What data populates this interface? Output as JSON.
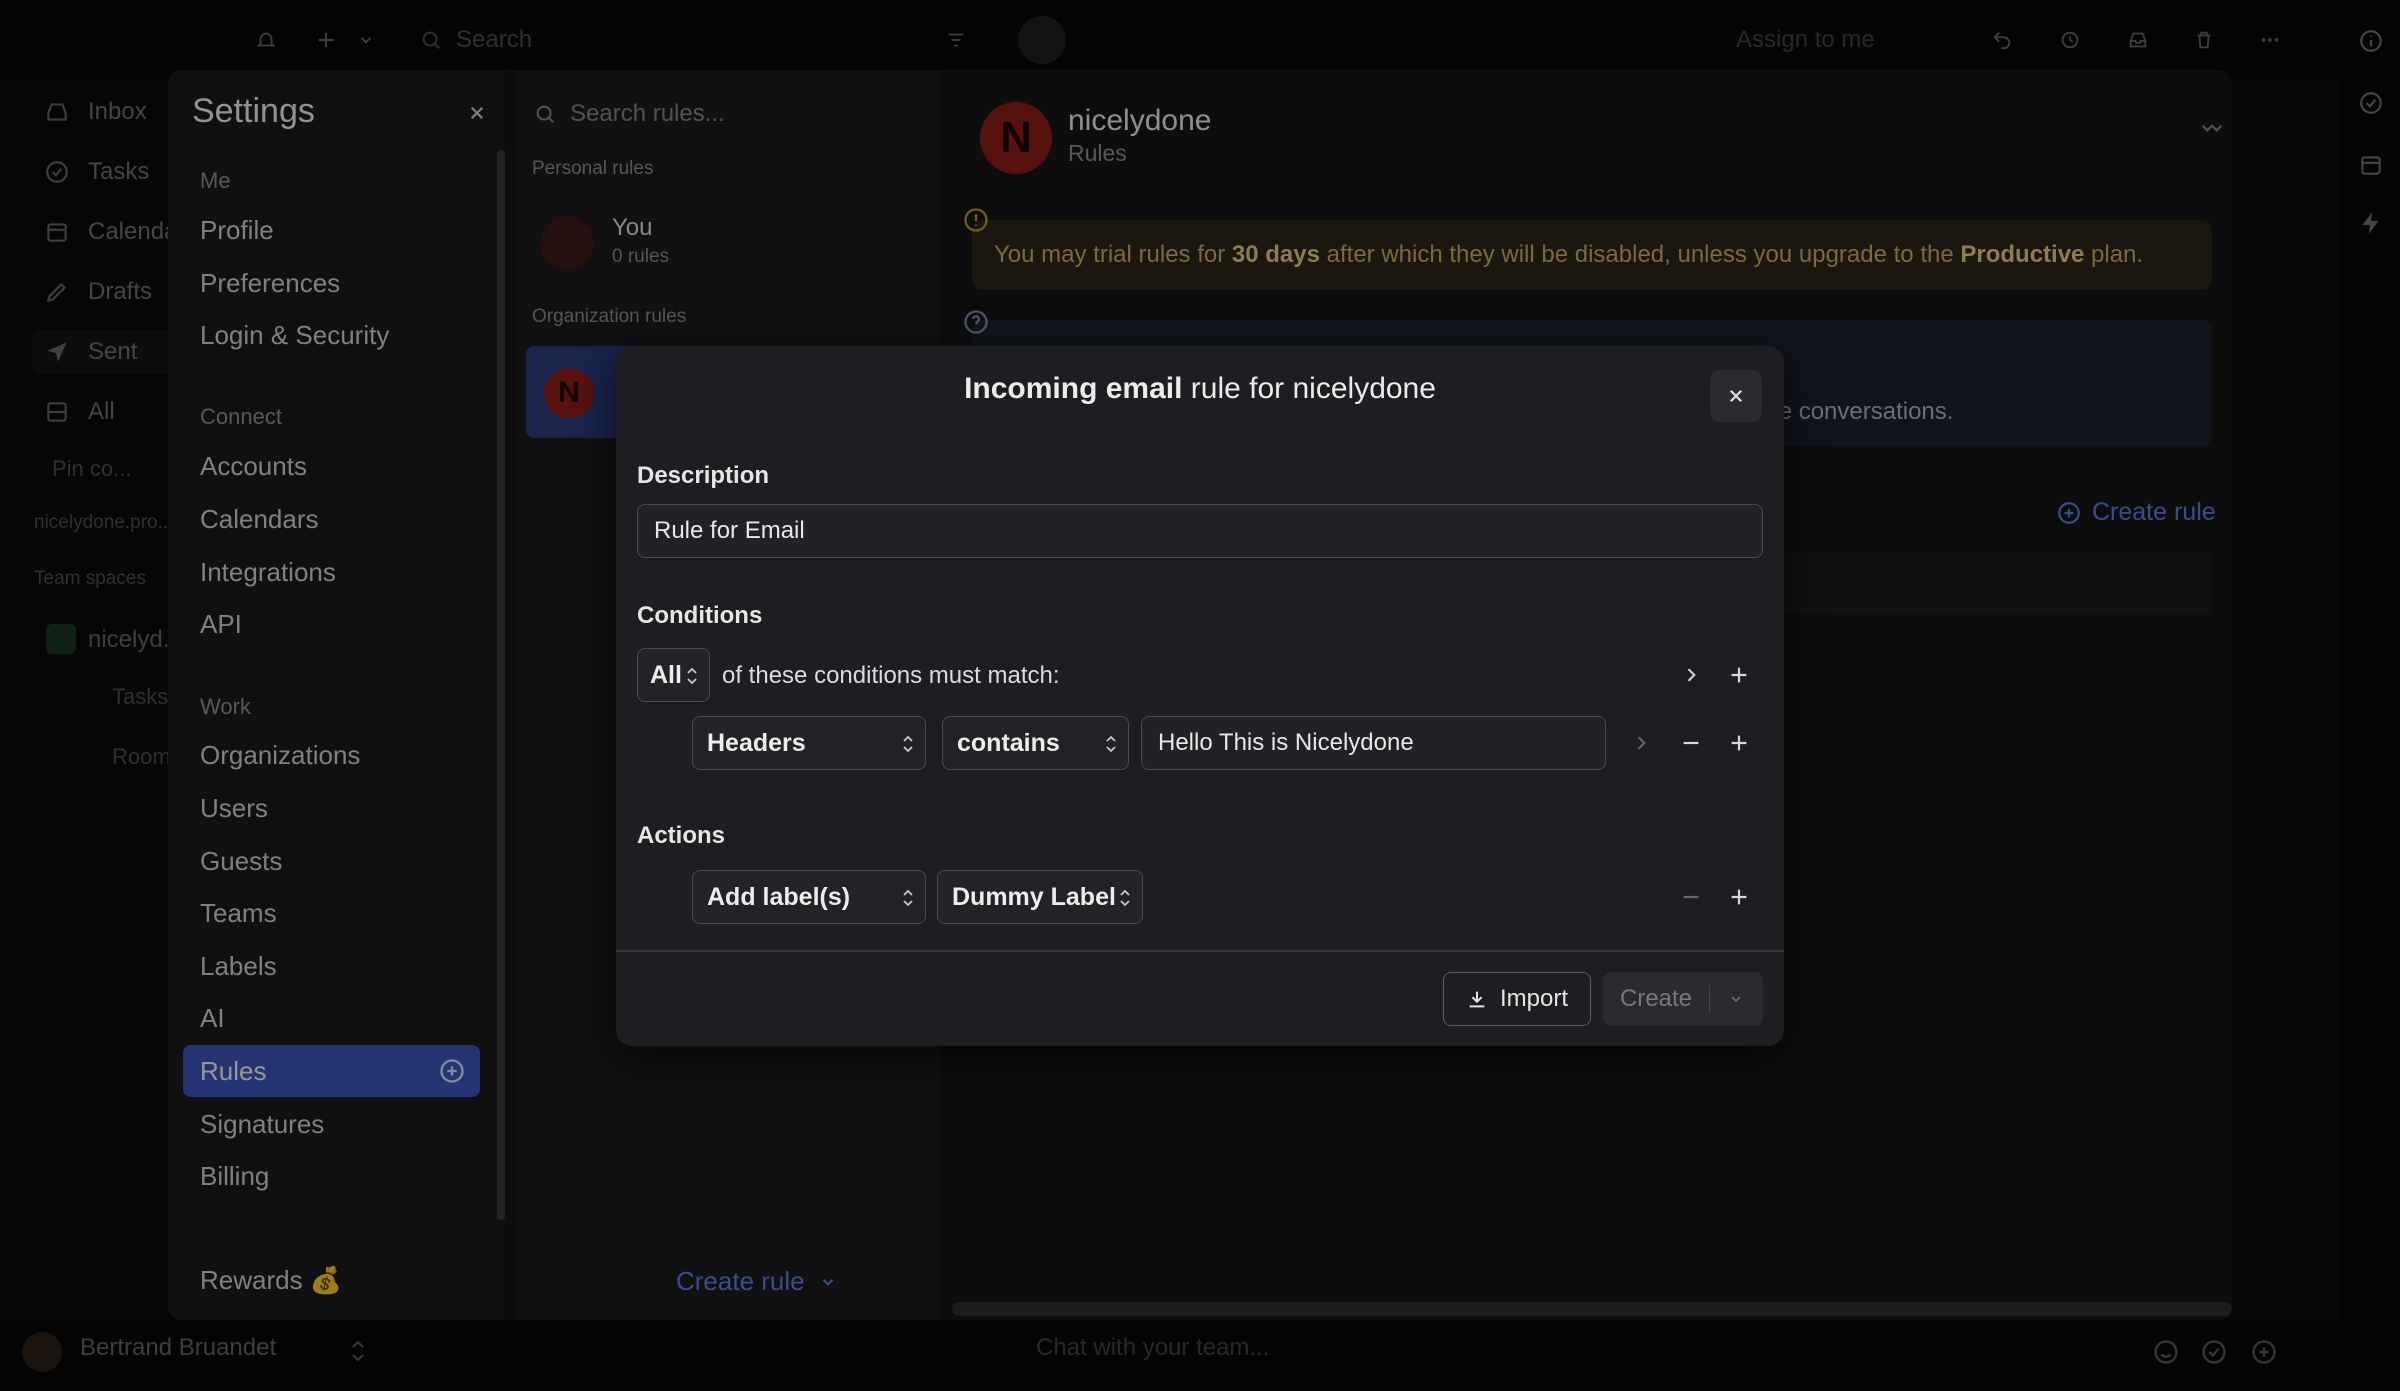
{
  "app": {
    "top_search_placeholder": "Search",
    "assign_label": "Assign to me",
    "nav": [
      {
        "label": "Inbox",
        "icon": "inbox-icon"
      },
      {
        "label": "Tasks",
        "icon": "check-circle-icon"
      },
      {
        "label": "Calendar",
        "icon": "calendar-icon"
      },
      {
        "label": "Drafts",
        "icon": "pencil-icon"
      },
      {
        "label": "Sent",
        "icon": "send-icon"
      },
      {
        "label": "All",
        "icon": "stack-icon"
      }
    ],
    "nav_partial": [
      "Pin co...",
      "nicelydone.pro...",
      "Team spaces"
    ],
    "team": {
      "name": "nicelyd...",
      "items": [
        "Tasks",
        "Room"
      ]
    },
    "user_name": "Bertrand Bruandet",
    "chat_placeholder": "Chat with your team..."
  },
  "settings": {
    "title": "Settings",
    "groups": [
      {
        "heading": "Me",
        "items": [
          "Profile",
          "Preferences",
          "Login & Security"
        ]
      },
      {
        "heading": "Connect",
        "items": [
          "Accounts",
          "Calendars",
          "Integrations",
          "API"
        ]
      },
      {
        "heading": "Work",
        "items": [
          "Organizations",
          "Users",
          "Guests",
          "Teams",
          "Labels",
          "AI",
          "Rules",
          "Signatures",
          "Billing"
        ]
      }
    ],
    "rewards": "Rewards 💰",
    "active_item": "Rules"
  },
  "rules_list": {
    "search_placeholder": "Search rules...",
    "personal_heading": "Personal rules",
    "personal": {
      "name": "You",
      "count": "0 rules"
    },
    "org_heading": "Organization rules",
    "org_avatar": "N",
    "create_label": "Create rule"
  },
  "rules_detail": {
    "avatar": "N",
    "org_name": "nicelydone",
    "subtitle": "Rules",
    "warning_pre": "You may trial rules for ",
    "warning_days": "30 days",
    "warning_mid": " after which they will be disabled, unless you upgrade to the ",
    "warning_plan": "Productive",
    "warning_post": " plan.",
    "info_fragment": "private conversations.",
    "create_label": "Create rule"
  },
  "modal": {
    "title_bold": "Incoming email",
    "title_rest": " rule for nicelydone",
    "description_label": "Description",
    "description_value": "Rule for Email",
    "conditions_label": "Conditions",
    "match_mode": "All",
    "match_text": "of these conditions must match:",
    "condition": {
      "field": "Headers",
      "operator": "contains",
      "value": "Hello This is Nicelydone"
    },
    "actions_label": "Actions",
    "action": {
      "type": "Add label(s)",
      "label": "Dummy Label"
    },
    "import_label": "Import",
    "create_label": "Create"
  },
  "colors": {
    "accent": "#3d55b8",
    "link": "#5e7ddb",
    "warning_text": "#c8aa66",
    "avatar_red": "#8d1d1a"
  }
}
